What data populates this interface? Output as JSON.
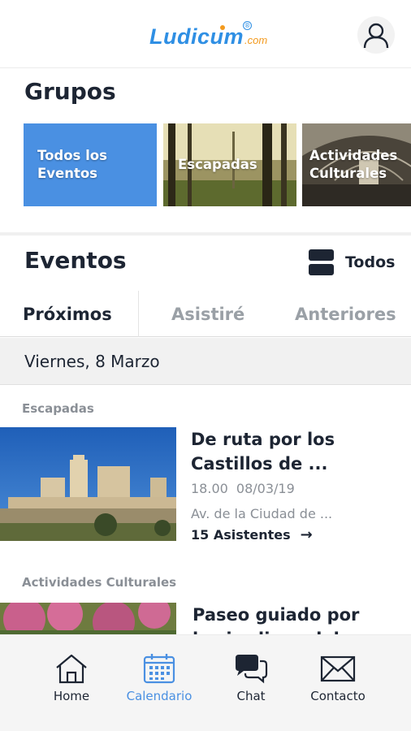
{
  "header": {
    "logo_main": "Ludicum",
    "logo_suffix": ".com",
    "logo_mark": "®",
    "profile_icon": "user-icon"
  },
  "groups": {
    "title": "Grupos",
    "cards": [
      {
        "label": "Todos los Eventos",
        "color": "#4a90e2"
      },
      {
        "label": "Escapadas"
      },
      {
        "label": "Actividades Culturales"
      }
    ]
  },
  "events": {
    "title": "Eventos",
    "filter_label": "Todos",
    "filter_icon": "view-toggle-icon",
    "tabs": [
      {
        "label": "Próximos",
        "active": true
      },
      {
        "label": "Asistiré",
        "active": false
      },
      {
        "label": "Anteriores",
        "active": false
      }
    ],
    "date_header": "Viernes, 8 Marzo",
    "items": [
      {
        "category": "Escapadas",
        "title_line1": "De ruta por los",
        "title_line2": "Castillos de ...",
        "time": "18.00",
        "date": "08/03/19",
        "address": "Av. de la Ciudad de ...",
        "attendees": "15 Asistentes",
        "arrow": "→"
      },
      {
        "category": "Actividades Culturales",
        "title_line1": "Paseo guiado por",
        "title_line2": "los jardines del"
      }
    ]
  },
  "bottom_nav": {
    "items": [
      {
        "label": "Home",
        "icon": "home-icon",
        "active": false
      },
      {
        "label": "Calendario",
        "icon": "calendar-icon",
        "active": true
      },
      {
        "label": "Chat",
        "icon": "chat-icon",
        "active": false
      },
      {
        "label": "Contacto",
        "icon": "envelope-icon",
        "active": false
      }
    ],
    "active_color": "#4a90e2"
  }
}
